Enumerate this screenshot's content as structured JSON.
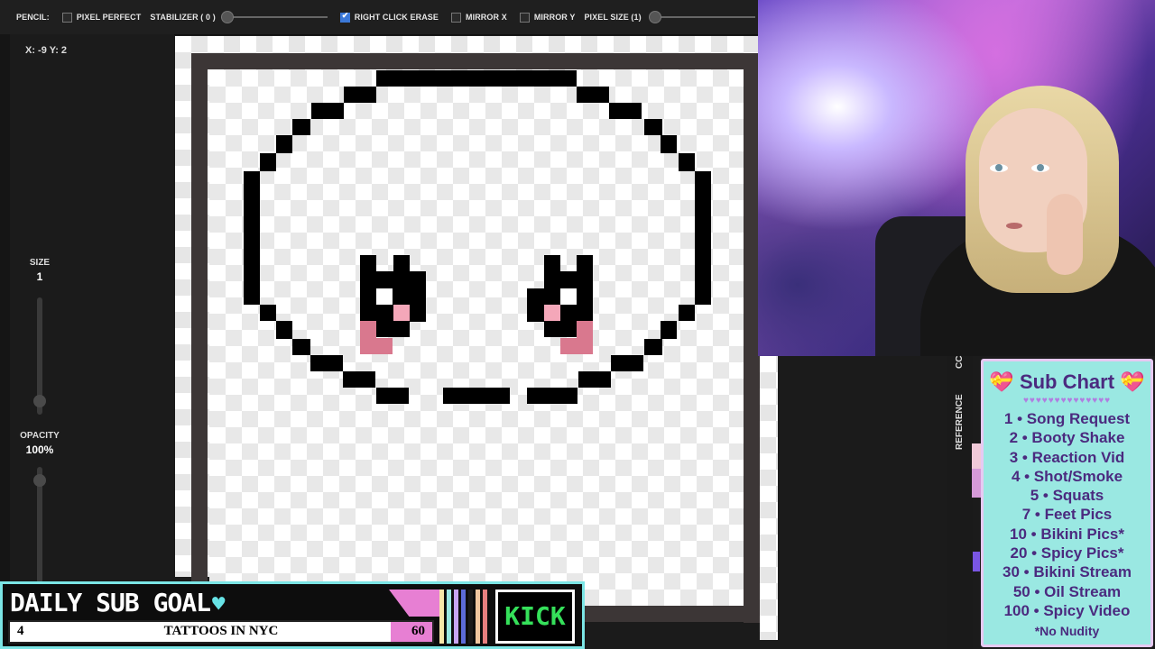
{
  "toolbar": {
    "tool": "PENCIL:",
    "pixel_perfect": "PIXEL PERFECT",
    "stabilizer": "STABILIZER ( 0 )",
    "right_click_erase": "RIGHT CLICK ERASE",
    "mirror_x": "MIRROR X",
    "mirror_y": "MIRROR Y",
    "pixel_size": "PIXEL SIZE (1)"
  },
  "left_panel": {
    "coords": "X: -9 Y: 2",
    "size_label": "SIZE",
    "size_value": "1",
    "opacity_label": "OPACITY",
    "opacity_value": "100%"
  },
  "side_tabs": {
    "cc": "CC",
    "reference": "REFERENCE"
  },
  "sub_chart": {
    "title": "Sub Chart",
    "heart_icon": "heart-ribbon-icon",
    "items": [
      "1 • Song Request",
      "2 • Booty Shake",
      "3 • Reaction Vid",
      "4 • Shot/Smoke",
      "5 • Squats",
      "7 • Feet Pics",
      "10 • Bikini Pics*",
      "20 • Spicy Pics*",
      "30 • Bikini Stream",
      "50 • Oil Stream",
      "100 • Spicy Video"
    ],
    "note": "*No Nudity"
  },
  "goal": {
    "title": "DAILY SUB GOAL",
    "current": "4",
    "text": "TATTOOS IN NYC",
    "target": "60",
    "progress_fraction": 0.067,
    "platform": "KICK"
  },
  "colors": {
    "accent_cyan": "#7be5e5",
    "pink": "#e77fd3",
    "kick_green": "#35e05a",
    "subchart_bg": "#9ae8e2"
  }
}
